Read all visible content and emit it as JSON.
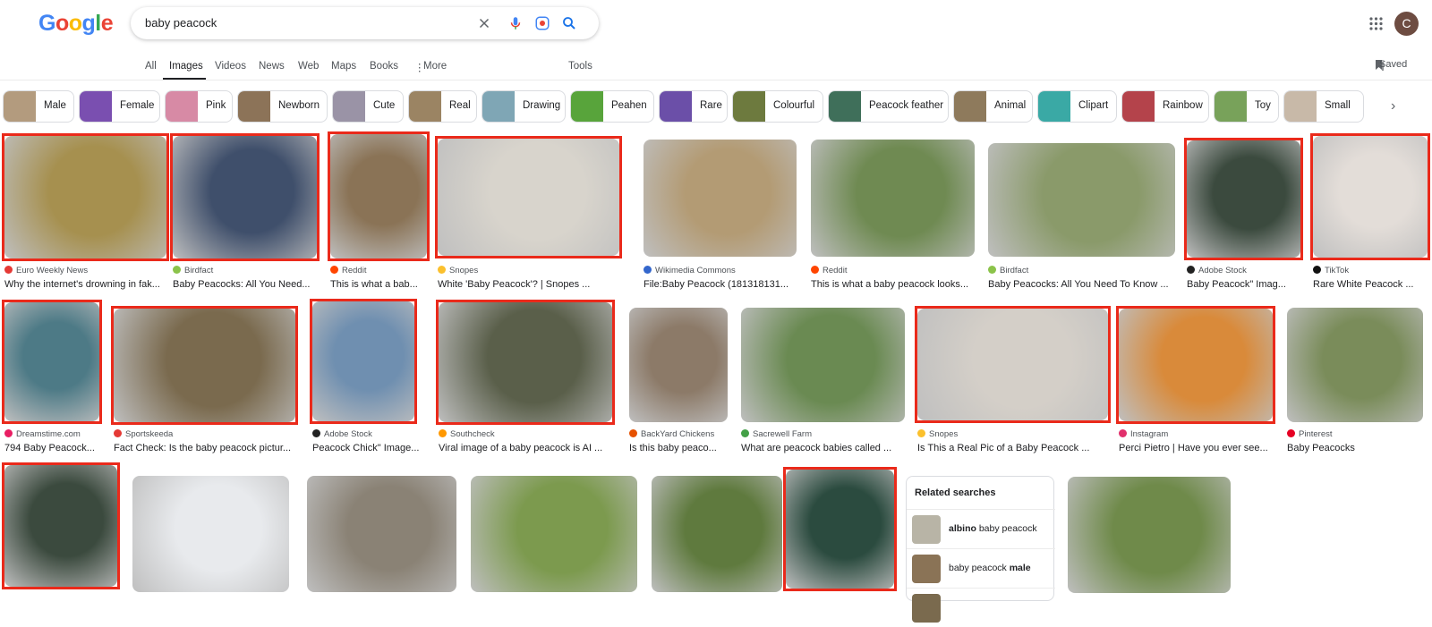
{
  "logo": {
    "letters": [
      "G",
      "o",
      "o",
      "g",
      "l",
      "e"
    ]
  },
  "search": {
    "query": "baby peacock",
    "icons": [
      "close-icon",
      "mic-icon",
      "lens-icon",
      "search-icon"
    ]
  },
  "account": {
    "initial": "C"
  },
  "tabs": [
    "All",
    "Images",
    "Videos",
    "News",
    "Web",
    "Maps",
    "Books",
    "More",
    "Tools"
  ],
  "saved_label": "Saved",
  "chips": [
    {
      "label": "Male",
      "color": "#b39b7e"
    },
    {
      "label": "Female",
      "color": "#7a4fb0"
    },
    {
      "label": "Pink",
      "color": "#d78aa5"
    },
    {
      "label": "Newborn",
      "color": "#8c7358"
    },
    {
      "label": "Cute",
      "color": "#9a93a6"
    },
    {
      "label": "Real",
      "color": "#9b8463"
    },
    {
      "label": "Drawing",
      "color": "#7fa6b5"
    },
    {
      "label": "Peahen",
      "color": "#58a43b"
    },
    {
      "label": "Rare",
      "color": "#6b4fa8"
    },
    {
      "label": "Colourful",
      "color": "#6d7a3e"
    },
    {
      "label": "Peacock feather",
      "color": "#3f6f5a"
    },
    {
      "label": "Animal",
      "color": "#8e7a5c"
    },
    {
      "label": "Clipart",
      "color": "#3aa9a5"
    },
    {
      "label": "Rainbow",
      "color": "#b4434b"
    },
    {
      "label": "Toy",
      "color": "#78a25a"
    },
    {
      "label": "Small",
      "color": "#c8b9a8"
    }
  ],
  "results": [
    {
      "source": "Euro Weekly News",
      "title": "Why the internet's drowning in fak...",
      "color": "#a6904f",
      "srcColor": "#e53935"
    },
    {
      "source": "Birdfact",
      "title": "Baby Peacocks: All You Need...",
      "color": "#3f4f6b",
      "srcColor": "#8bc34a"
    },
    {
      "source": "Reddit",
      "title": "This is what a bab...",
      "color": "#8a7356",
      "srcColor": "#ff4500"
    },
    {
      "source": "Snopes",
      "title": "White 'Baby Peacock'? | Snopes ...",
      "color": "#d8d4cc",
      "srcColor": "#fbc02d"
    },
    {
      "source": "Wikimedia Commons",
      "title": "File:Baby Peacock (181318131...",
      "color": "#b39b74",
      "srcColor": "#3366cc"
    },
    {
      "source": "Reddit",
      "title": "This is what a baby peacock looks...",
      "color": "#6f8a52",
      "srcColor": "#ff4500"
    },
    {
      "source": "Birdfact",
      "title": "Baby Peacocks: All You Need To Know ...",
      "color": "#8a9a6a",
      "srcColor": "#8bc34a"
    },
    {
      "source": "Adobe Stock",
      "title": "Baby Peacock\" Imag...",
      "color": "#3b4a3e",
      "srcColor": "#222222"
    },
    {
      "source": "TikTok",
      "title": "Rare White Peacock ...",
      "color": "#e3ddd8",
      "srcColor": "#111111"
    },
    {
      "source": "Dreamstime.com",
      "title": "794 Baby Peacock...",
      "color": "#4d7a86",
      "srcColor": "#e91e63"
    },
    {
      "source": "Sportskeeda",
      "title": "Fact Check: Is the baby peacock pictur...",
      "color": "#7a6a4e",
      "srcColor": "#e53935"
    },
    {
      "source": "Adobe Stock",
      "title": "Peacock Chick\" Image...",
      "color": "#6f8fb0",
      "srcColor": "#222222"
    },
    {
      "source": "Southcheck",
      "title": "Viral image of a baby peacock is AI ...",
      "color": "#5a5f4a",
      "srcColor": "#ff9800"
    },
    {
      "source": "BackYard Chickens",
      "title": "Is this baby peaco...",
      "color": "#8c7a68",
      "srcColor": "#e65100"
    },
    {
      "source": "Sacrewell Farm",
      "title": "What are peacock babies called ...",
      "color": "#6a8a52",
      "srcColor": "#43a047"
    },
    {
      "source": "Snopes",
      "title": "Is This a Real Pic of a Baby Peacock ...",
      "color": "#d4cfc8",
      "srcColor": "#fbc02d"
    },
    {
      "source": "Instagram",
      "title": "Perci Pietro | Have you ever see...",
      "color": "#d98a3a",
      "srcColor": "#e1306c"
    },
    {
      "source": "Pinterest",
      "title": "Baby Peacocks",
      "color": "#7a8c5a",
      "srcColor": "#e60023"
    },
    {
      "source": "",
      "title": "",
      "color": "#3b4a3e",
      "srcColor": ""
    },
    {
      "source": "",
      "title": "",
      "color": "#e8eaed",
      "srcColor": ""
    },
    {
      "source": "",
      "title": "",
      "color": "#8a8275",
      "srcColor": ""
    },
    {
      "source": "",
      "title": "",
      "color": "#7c9a4e",
      "srcColor": ""
    },
    {
      "source": "",
      "title": "",
      "color": "#5f7a3e",
      "srcColor": ""
    },
    {
      "source": "",
      "title": "",
      "color": "#2b4b3f",
      "srcColor": ""
    },
    {
      "source": "",
      "title": "",
      "color": "#5a6a6a",
      "srcColor": ""
    },
    {
      "source": "",
      "title": "",
      "color": "#6f8a4a",
      "srcColor": ""
    }
  ],
  "related": {
    "heading": "Related searches",
    "items": [
      {
        "bold": "albino",
        "rest": " baby peacock",
        "color": "#b8b4a6"
      },
      {
        "pre": "baby peacock ",
        "bold": "male",
        "color": "#8a7356"
      }
    ]
  },
  "colors": {
    "highlight": "#ea2a1b",
    "accent": "#1a73e8"
  }
}
